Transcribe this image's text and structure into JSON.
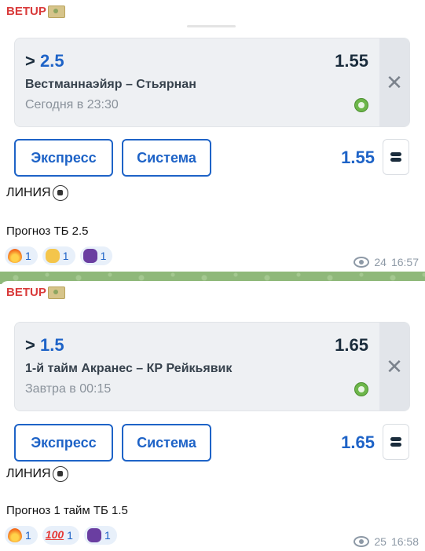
{
  "messages": [
    {
      "sender": "BETUP",
      "bet": {
        "selection_prefix": ">",
        "selection_value": "2.5",
        "odds": "1.55",
        "match": "Вестманнаэйяр – Стьярнан",
        "time": "Сегодня в 23:30"
      },
      "buttons": {
        "express": "Экспресс",
        "system": "Система"
      },
      "total_odds": "1.55",
      "line_text": "ЛИНИЯ",
      "forecast": "Прогноз ТБ 2.5",
      "reactions": [
        {
          "icon": "fire-emoji",
          "count": "1"
        },
        {
          "icon": "clap-emoji",
          "count": "1"
        },
        {
          "icon": "alien-emoji",
          "count": "1"
        }
      ],
      "views": "24",
      "timestamp": "16:57"
    },
    {
      "sender": "BETUP",
      "bet": {
        "selection_prefix": ">",
        "selection_value": "1.5",
        "odds": "1.65",
        "match": "1-й тайм Акранес – КР Рейкьявик",
        "time": "Завтра в 00:15"
      },
      "buttons": {
        "express": "Экспресс",
        "system": "Система"
      },
      "total_odds": "1.65",
      "line_text": "ЛИНИЯ",
      "forecast": "Прогноз 1 тайм ТБ 1.5",
      "reactions": [
        {
          "icon": "fire-emoji",
          "count": "1"
        },
        {
          "icon": "hundred-emoji",
          "label": "100",
          "count": "1"
        },
        {
          "icon": "alien-emoji",
          "count": "1"
        }
      ],
      "views": "25",
      "timestamp": "16:58"
    }
  ],
  "colors": {
    "accent": "#1e63c7",
    "sender": "#d93b3b",
    "chat_background": "#8fb87a"
  }
}
